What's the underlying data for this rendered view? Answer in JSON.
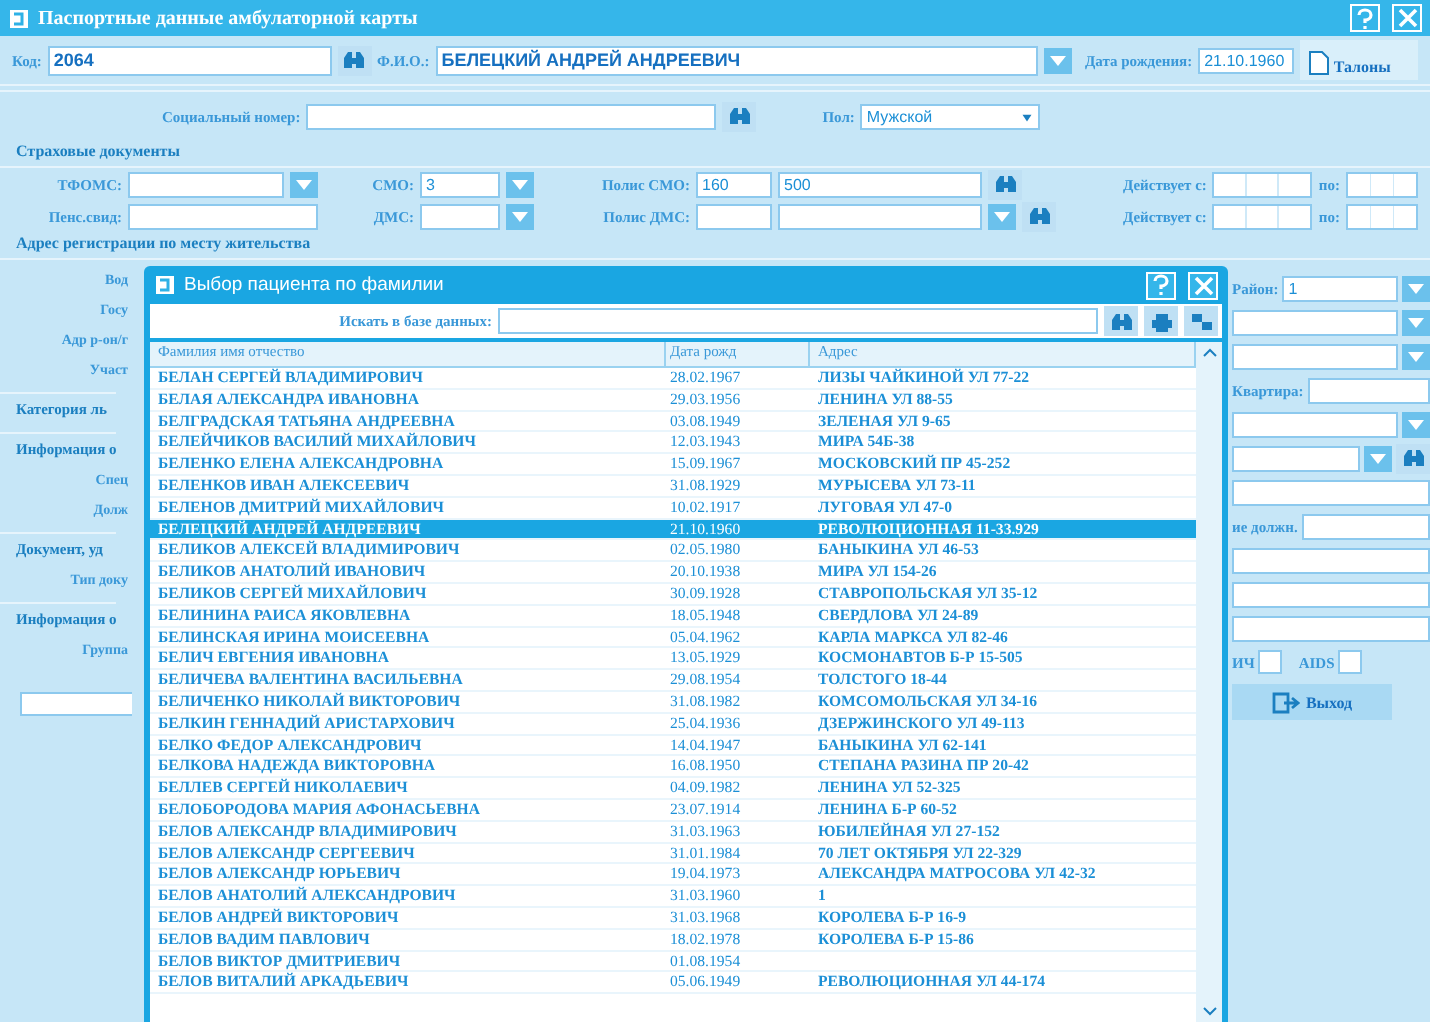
{
  "window": {
    "title": "Паспортные данные амбулаторной карты"
  },
  "header": {
    "code_label": "Код:",
    "code": "2064",
    "fio_label": "Ф.И.О.:",
    "fio": "БЕЛЕЦКИЙ АНДРЕЙ АНДРЕЕВИЧ",
    "dob_label": "Дата рождения:",
    "dob": "21.10.1960",
    "talons_button": "Талоны"
  },
  "social": {
    "label": "Социальный номер:",
    "sex_label": "Пол:",
    "sex": "Мужской"
  },
  "insurance": {
    "title": "Страховые документы",
    "tfoms_label": "ТФОМС:",
    "smo_label": "СМО:",
    "smo": "3",
    "polis_smo_label": "Полис СМО:",
    "polis_smo_series": "160",
    "polis_smo_number": "500",
    "valid_from_label": "Действует с:",
    "valid_to_label": "по:",
    "pens_label": "Пенс.свид:",
    "dms_label": "ДМС:",
    "polis_dms_label": "Полис ДМС:",
    "valid_from_label_2": "Действует с:",
    "valid_to_label_2": "по:"
  },
  "address_title": "Адрес регистрации по месту жительства",
  "left_strip": [
    {
      "kind": "label",
      "text": "Вод"
    },
    {
      "kind": "label",
      "text": "Госу"
    },
    {
      "kind": "label",
      "text": "Адр р-он/г"
    },
    {
      "kind": "label",
      "text": "Участ"
    },
    {
      "kind": "heading",
      "text": "Категория ль"
    },
    {
      "kind": "heading",
      "text": "Информация о"
    },
    {
      "kind": "label",
      "text": "Спец"
    },
    {
      "kind": "label",
      "text": "Долж"
    },
    {
      "kind": "heading",
      "text": "Документ, уд"
    },
    {
      "kind": "label",
      "text": "Тип доку"
    },
    {
      "kind": "heading",
      "text": "Информация о"
    },
    {
      "kind": "label",
      "text": "Группа"
    },
    {
      "kind": "field"
    }
  ],
  "right_strip": [
    {
      "kind": "labeled",
      "label": "Район:",
      "value": "1",
      "dropdown": true
    },
    {
      "kind": "field",
      "dropdown": true
    },
    {
      "kind": "field",
      "dropdown": true
    },
    {
      "kind": "labeled",
      "label": "Квартира:"
    },
    {
      "kind": "field",
      "dropdown": true
    },
    {
      "kind": "field",
      "dropdown": true,
      "search": true
    },
    {
      "kind": "field"
    },
    {
      "kind": "labeled",
      "label": "ие должн."
    },
    {
      "kind": "field"
    },
    {
      "kind": "field"
    },
    {
      "kind": "field"
    },
    {
      "kind": "checks",
      "items": [
        {
          "label": "ИЧ",
          "checked": false
        },
        {
          "label": "AIDS",
          "checked": false
        }
      ]
    },
    {
      "kind": "button",
      "label": "Выход"
    }
  ],
  "dialog": {
    "title": "Выбор пациента по фамилии",
    "search_label": "Искать в базе данных:",
    "columns": [
      "Фамилия имя отчество",
      "Дата рожд",
      "Адрес"
    ],
    "rows": [
      {
        "name": "БЕЛАН СЕРГЕЙ ВЛАДИМИРОВИЧ",
        "dob": "28.02.1967",
        "address": "ЛИЗЫ ЧАЙКИНОЙ УЛ 77-22",
        "selected": false
      },
      {
        "name": "БЕЛАЯ АЛЕКСАНДРА ИВАНОВНА",
        "dob": "29.03.1956",
        "address": "ЛЕНИНА УЛ 88-55",
        "selected": false
      },
      {
        "name": "БЕЛГРАДСКАЯ ТАТЬЯНА АНДРЕЕВНА",
        "dob": "03.08.1949",
        "address": "ЗЕЛЕНАЯ УЛ 9-65",
        "selected": false
      },
      {
        "name": "БЕЛЕЙЧИКОВ ВАСИЛИЙ МИХАЙЛОВИЧ",
        "dob": "12.03.1943",
        "address": "МИРА 54Б-38",
        "selected": false
      },
      {
        "name": "БЕЛЕНКО ЕЛЕНА АЛЕКСАНДРОВНА",
        "dob": "15.09.1967",
        "address": "МОСКОВСКИЙ ПР 45-252",
        "selected": false
      },
      {
        "name": "БЕЛЕНКОВ ИВАН АЛЕКСЕЕВИЧ",
        "dob": "31.08.1929",
        "address": "МУРЫСЕВА УЛ 73-11",
        "selected": false
      },
      {
        "name": "БЕЛЕНОВ ДМИТРИЙ МИХАЙЛОВИЧ",
        "dob": "10.02.1917",
        "address": "ЛУГОВАЯ УЛ 47-0",
        "selected": false
      },
      {
        "name": "БЕЛЕЦКИЙ АНДРЕЙ АНДРЕЕВИЧ",
        "dob": "21.10.1960",
        "address": "РЕВОЛЮЦИОННАЯ 11-33.929",
        "selected": true
      },
      {
        "name": "БЕЛИКОВ АЛЕКСЕЙ ВЛАДИМИРОВИЧ",
        "dob": "02.05.1980",
        "address": "БАНЫКИНА УЛ 46-53",
        "selected": false
      },
      {
        "name": "БЕЛИКОВ АНАТОЛИЙ ИВАНОВИЧ",
        "dob": "20.10.1938",
        "address": "МИРА УЛ 154-26",
        "selected": false
      },
      {
        "name": "БЕЛИКОВ СЕРГЕЙ МИХАЙЛОВИЧ",
        "dob": "30.09.1928",
        "address": "СТАВРОПОЛЬСКАЯ УЛ 35-12",
        "selected": false
      },
      {
        "name": "БЕЛИНИНА РАИСА ЯКОВЛЕВНА",
        "dob": "18.05.1948",
        "address": "СВЕРДЛОВА УЛ 24-89",
        "selected": false
      },
      {
        "name": "БЕЛИНСКАЯ ИРИНА МОИСЕЕВНА",
        "dob": "05.04.1962",
        "address": "КАРЛА МАРКСА УЛ 82-46",
        "selected": false
      },
      {
        "name": "БЕЛИЧ ЕВГЕНИЯ ИВАНОВНА",
        "dob": "13.05.1929",
        "address": "КОСМОНАВТОВ Б-Р 15-505",
        "selected": false
      },
      {
        "name": "БЕЛИЧЕВА ВАЛЕНТИНА ВАСИЛЬЕВНА",
        "dob": "29.08.1954",
        "address": "ТОЛСТОГО 18-44",
        "selected": false
      },
      {
        "name": "БЕЛИЧЕНКО НИКОЛАЙ ВИКТОРОВИЧ",
        "dob": "31.08.1982",
        "address": "КОМСОМОЛЬСКАЯ УЛ 34-16",
        "selected": false
      },
      {
        "name": "БЕЛКИН ГЕННАДИЙ АРИСТАРХОВИЧ",
        "dob": "25.04.1936",
        "address": "ДЗЕРЖИНСКОГО УЛ 49-113",
        "selected": false
      },
      {
        "name": "БЕЛКО ФЕДОР АЛЕКСАНДРОВИЧ",
        "dob": "14.04.1947",
        "address": "БАНЫКИНА УЛ 62-141",
        "selected": false
      },
      {
        "name": "БЕЛКОВА НАДЕЖДА ВИКТОРОВНА",
        "dob": "16.08.1950",
        "address": "СТЕПАНА РАЗИНА ПР 20-42",
        "selected": false
      },
      {
        "name": "БЕЛЛЕВ СЕРГЕЙ НИКОЛАЕВИЧ",
        "dob": "04.09.1982",
        "address": "ЛЕНИНА УЛ 52-325",
        "selected": false
      },
      {
        "name": "БЕЛОБОРОДОВА МАРИЯ АФОНАСЬЕВНА",
        "dob": "23.07.1914",
        "address": "ЛЕНИНА Б-Р 60-52",
        "selected": false
      },
      {
        "name": "БЕЛОВ АЛЕКСАНДР ВЛАДИМИРОВИЧ",
        "dob": "31.03.1963",
        "address": "ЮБИЛЕЙНАЯ УЛ 27-152",
        "selected": false
      },
      {
        "name": "БЕЛОВ АЛЕКСАНДР СЕРГЕЕВИЧ",
        "dob": "31.01.1984",
        "address": "70 ЛЕТ ОКТЯБРЯ УЛ 22-329",
        "selected": false
      },
      {
        "name": "БЕЛОВ АЛЕКСАНДР ЮРЬЕВИЧ",
        "dob": "19.04.1973",
        "address": "АЛЕКСАНДРА МАТРОСОВА УЛ 42-32",
        "selected": false
      },
      {
        "name": "БЕЛОВ АНАТОЛИЙ АЛЕКСАНДРОВИЧ",
        "dob": "31.03.1960",
        "address": "1",
        "selected": false
      },
      {
        "name": "БЕЛОВ АНДРЕЙ ВИКТОРОВИЧ",
        "dob": "31.03.1968",
        "address": "КОРОЛЕВА Б-Р 16-9",
        "selected": false
      },
      {
        "name": "БЕЛОВ ВАДИМ ПАВЛОВИЧ",
        "dob": "18.02.1978",
        "address": "КОРОЛЕВА Б-Р 15-86",
        "selected": false
      },
      {
        "name": "БЕЛОВ ВИКТОР ДМИТРИЕВИЧ",
        "dob": "01.08.1954",
        "selected": false
      },
      {
        "name": "БЕЛОВ ВИТАЛИЙ АРКАДЬЕВИЧ",
        "dob": "05.06.1949",
        "address": "РЕВОЛЮЦИОННАЯ УЛ 44-174",
        "selected": false
      }
    ]
  }
}
